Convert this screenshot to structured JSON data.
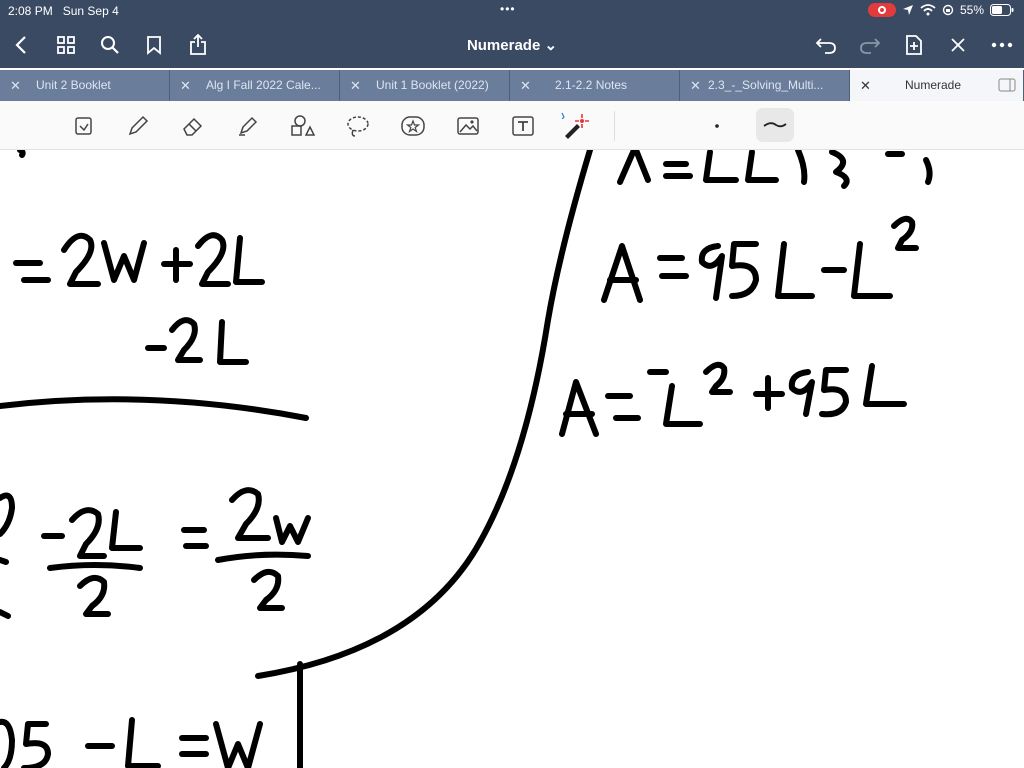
{
  "status": {
    "time": "2:08 PM",
    "date": "Sun Sep 4",
    "battery": "55%"
  },
  "app": {
    "title": "Numerade ⌄"
  },
  "tabs": [
    {
      "label": "Unit 2 Booklet"
    },
    {
      "label": "Alg I Fall 2022 Cale..."
    },
    {
      "label": "Unit 1 Booklet (2022)"
    },
    {
      "label": "2.1-2.2 Notes"
    },
    {
      "label": "2.3_-_Solving_Multi..."
    },
    {
      "label": "Numerade"
    }
  ],
  "icons": {
    "back": "chevron-left-icon",
    "grid": "grid-icon",
    "search": "search-icon",
    "bookmark": "bookmark-icon",
    "share": "share-icon",
    "undo": "undo-icon",
    "redo": "redo-icon",
    "add-page": "add-page-icon",
    "close": "close-icon",
    "more": "more-icon"
  },
  "colors": {
    "nav": "#3b4a63",
    "tabs": "#6a7d9a",
    "ink": "#000000",
    "record": "#e23b3b"
  }
}
